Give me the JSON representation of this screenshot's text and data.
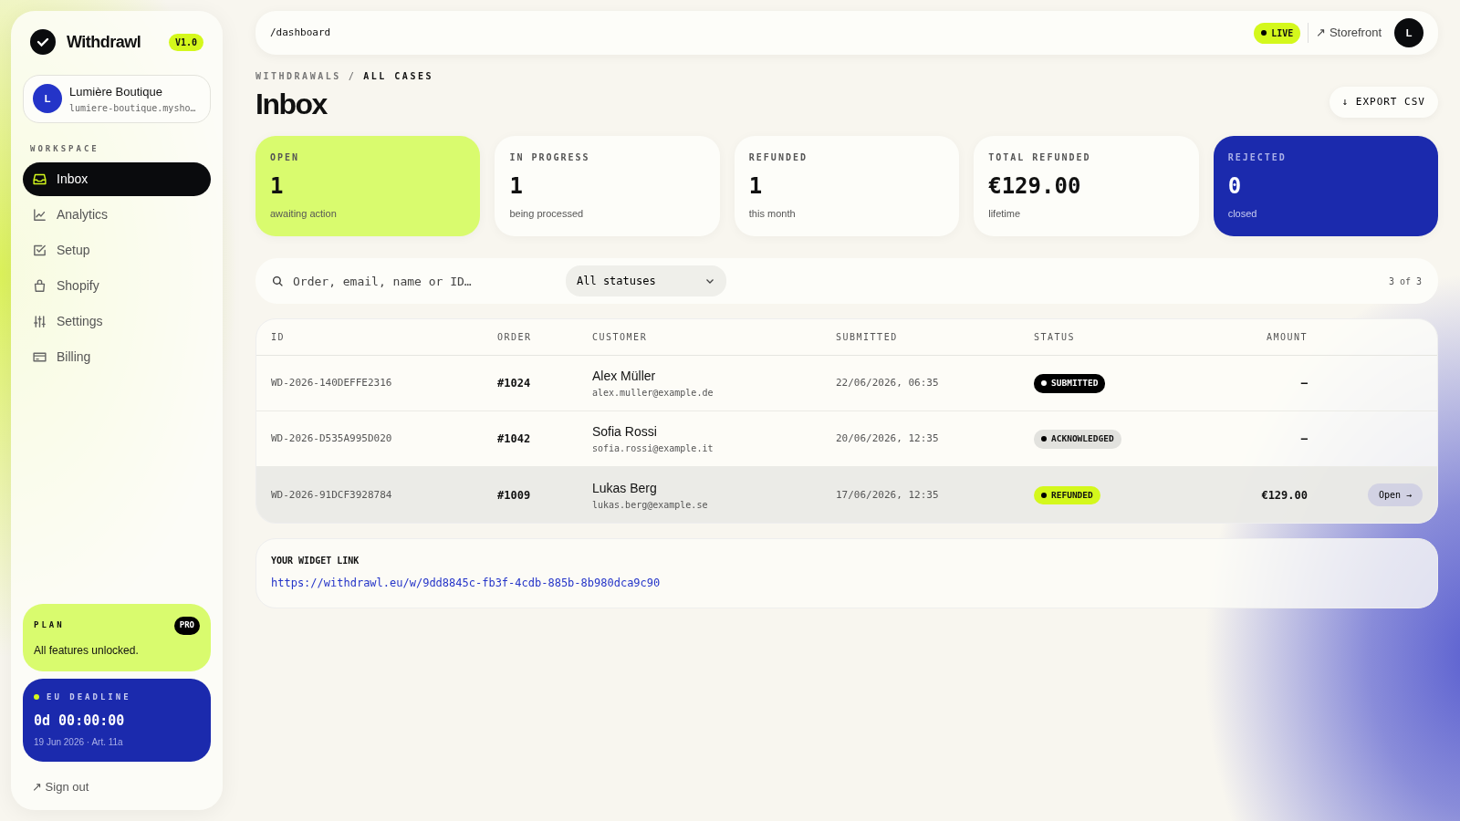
{
  "brand": {
    "name": "Withdrawl",
    "version": "V1.0"
  },
  "shop": {
    "avatar": "L",
    "name": "Lumière Boutique",
    "domain": "lumiere-boutique.mysho…"
  },
  "sidebar": {
    "section": "WORKSPACE",
    "items": [
      {
        "label": "Inbox",
        "selected": true
      },
      {
        "label": "Analytics",
        "selected": false
      },
      {
        "label": "Setup",
        "selected": false
      },
      {
        "label": "Shopify",
        "selected": false
      },
      {
        "label": "Settings",
        "selected": false
      },
      {
        "label": "Billing",
        "selected": false
      }
    ]
  },
  "plan": {
    "label": "PLAN",
    "badge": "PRO",
    "text": "All features unlocked."
  },
  "deadline": {
    "label": "EU DEADLINE",
    "countdown": "0d 00:00:00",
    "note": "19 Jun 2026 · Art. 11a"
  },
  "sign_out": "↗ Sign out",
  "topbar": {
    "path": "/dashboard",
    "live": "LIVE",
    "storefront": "↗ Storefront",
    "avatar": "L"
  },
  "breadcrumb": [
    "WITHDRAWALS",
    "/",
    "ALL CASES"
  ],
  "title": "Inbox",
  "export_button": "↓ EXPORT CSV",
  "stats": [
    {
      "label": "OPEN",
      "value": "1",
      "note": "awaiting action",
      "kind": "lime"
    },
    {
      "label": "IN PROGRESS",
      "value": "1",
      "note": "being processed",
      "kind": "plain"
    },
    {
      "label": "REFUNDED",
      "value": "1",
      "note": "this month",
      "kind": "plain"
    },
    {
      "label": "TOTAL REFUNDED",
      "value": "€129.00",
      "note": "lifetime",
      "kind": "plain"
    },
    {
      "label": "REJECTED",
      "value": "0",
      "note": "closed",
      "kind": "blue"
    }
  ],
  "filter": {
    "placeholder": "Order, email, name or ID…",
    "status_select": "All statuses",
    "count": "3 of 3"
  },
  "table": {
    "columns": [
      "ID",
      "ORDER",
      "CUSTOMER",
      "SUBMITTED",
      "STATUS",
      "AMOUNT"
    ],
    "rows": [
      {
        "id": "WD-2026-140DEFFE2316",
        "order": "#1024",
        "name": "Alex Müller",
        "email": "alex.muller@example.de",
        "submitted": "22/06/2026, 06:35",
        "status": "SUBMITTED",
        "kind": "submitted",
        "amount": "–",
        "selected": false
      },
      {
        "id": "WD-2026-D535A995D020",
        "order": "#1042",
        "name": "Sofia Rossi",
        "email": "sofia.rossi@example.it",
        "submitted": "20/06/2026, 12:35",
        "status": "ACKNOWLEDGED",
        "kind": "acknowledged",
        "amount": "–",
        "selected": false
      },
      {
        "id": "WD-2026-91DCF3928784",
        "order": "#1009",
        "name": "Lukas Berg",
        "email": "lukas.berg@example.se",
        "submitted": "17/06/2026, 12:35",
        "status": "REFUNDED",
        "kind": "refunded",
        "amount": "€129.00",
        "selected": true,
        "action": "Open →"
      }
    ]
  },
  "widget": {
    "label": "YOUR WIDGET LINK",
    "url": "https://withdrawl.eu/w/9dd8845c-fb3f-4cdb-885b-8b980dca9c90"
  }
}
